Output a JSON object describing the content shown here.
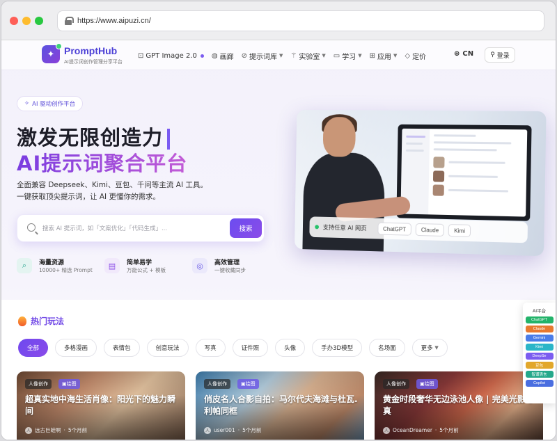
{
  "browser": {
    "url": "https://www.aipuzi.cn/"
  },
  "nav": {
    "brand": "PromptHub",
    "brand_sub": "AI提示词创作管理分享平台",
    "items": [
      {
        "label": "GPT Image 2.0",
        "icon": "image-icon"
      },
      {
        "label": "画廊",
        "icon": "palette-icon"
      },
      {
        "label": "提示词库",
        "icon": "compass-icon"
      },
      {
        "label": "实验室",
        "icon": "wand-icon"
      },
      {
        "label": "学习",
        "icon": "book-icon"
      },
      {
        "label": "应用",
        "icon": "grid-icon"
      },
      {
        "label": "定价",
        "icon": "diamond-icon"
      }
    ],
    "lang": "CN",
    "login": "登录"
  },
  "hero": {
    "pill": "AI 驱动创作平台",
    "title_line1": "激发无限创造力",
    "title_line2": "AI提示词聚合平台",
    "desc_line1": "全面兼容 Deepseek、Kimi、豆包、千问等主流 AI 工具。",
    "desc_line2": "一键获取顶尖提示词，让 AI 更懂你的需求。",
    "search_placeholder": "搜索 AI 提示词，如「文案优化」「代码生成」...",
    "search_button": "搜索",
    "features": [
      {
        "title": "海量资源",
        "sub": "10000+ 精选 Prompt",
        "color": "#e4f4f1",
        "fg": "#23a38d",
        "icon": "search-icon"
      },
      {
        "title": "简单易学",
        "sub": "万能公式 + 模板",
        "color": "#f1e9fb",
        "fg": "#8a4be9",
        "icon": "book-icon"
      },
      {
        "title": "高效管理",
        "sub": "一键收藏同步",
        "color": "#ebe9fb",
        "fg": "#6b5be6",
        "icon": "target-icon"
      }
    ]
  },
  "hero_card": {
    "overlay_label": "支持任意 AI 网页",
    "chips": [
      "ChatGPT",
      "Claude",
      "Kimi"
    ]
  },
  "hot": {
    "title": "热门玩法",
    "filters": [
      "全部",
      "多格漫画",
      "表情包",
      "创意玩法",
      "写真",
      "证件照",
      "头像",
      "手办3D模型",
      "名场面",
      "更多"
    ],
    "cards": [
      {
        "tag1": "人像创作",
        "tag2": "绘图",
        "title": "超真实地中海生活肖像：阳光下的魅力瞬间",
        "author": "远古巨蛙啊",
        "time": "5个月前",
        "bg": "linear-gradient(135deg,#6f4a34 0%,#c99070 35%,#e8c7a3 60%,#8a6a55 100%)"
      },
      {
        "tag1": "人像创作",
        "tag2": "绘图",
        "title": "俏皮名人合影自拍：马尔代夫海滩与杜瓦.利帕同框",
        "author": "user001",
        "time": "5个月前",
        "bg": "linear-gradient(135deg,#3f7fb0 0%,#b9d3e4 35%,#e0b896 55%,#c48e6d 80%,#7fa7c8 100%)"
      },
      {
        "tag1": "人像创作",
        "tag2": "绘图",
        "title": "黄金时段奢华无边泳池人像 | 完美光影写真",
        "author": "OceanDreamer",
        "time": "5个月前",
        "bg": "linear-gradient(135deg,#3a2a25 0%,#8c3a3a 35%,#d46b4e 55%,#e9b48d 75%,#6a4a3c 100%)"
      }
    ]
  },
  "platform_panel": {
    "title": "AI平台",
    "buttons": [
      {
        "label": "ChatGPT",
        "color": "#23b36a"
      },
      {
        "label": "Claude",
        "color": "#e8792f"
      },
      {
        "label": "Gemini",
        "color": "#4a7ce8"
      },
      {
        "label": "Kimi",
        "color": "#2bb5c8"
      },
      {
        "label": "DeepSe",
        "color": "#7b5cf0"
      },
      {
        "label": "豆包",
        "color": "#e2a72a"
      },
      {
        "label": "智谱清言",
        "color": "#25a88b"
      },
      {
        "label": "Copilot",
        "color": "#4a6ee0"
      }
    ]
  }
}
